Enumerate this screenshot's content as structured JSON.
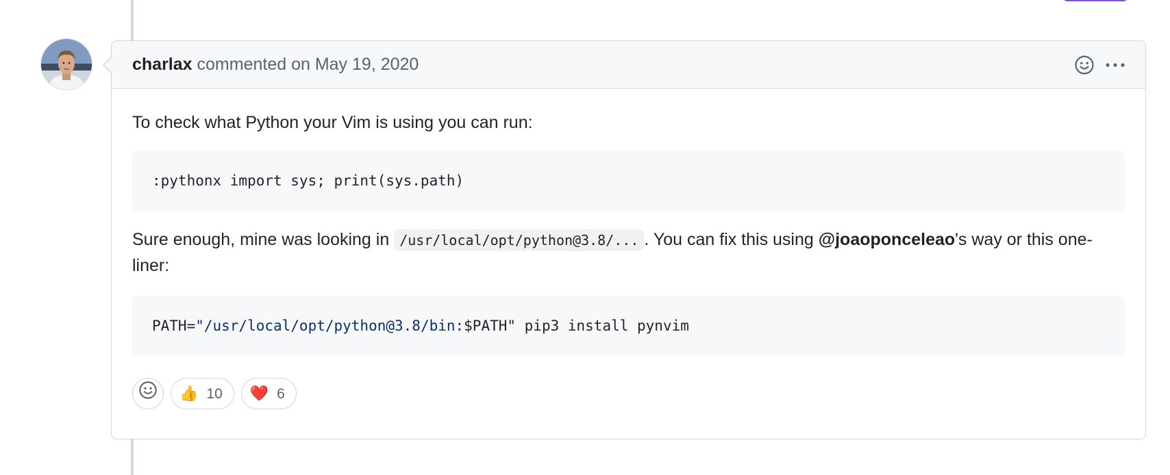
{
  "comment": {
    "author": "charlax",
    "action_text": " commented on May 19, 2020",
    "body": {
      "para1": "To check what Python your Vim is using you can run:",
      "code1": ":pythonx import sys; print(sys.path)",
      "para2_before": "Sure enough, mine was looking in ",
      "para2_code": "/usr/local/opt/python@3.8/...",
      "para2_middle": ". You can fix this using ",
      "para2_mention": "@joaoponceleao",
      "para2_after": "'s way or this one-liner:",
      "code2_prefix": "PATH=",
      "code2_string": "\"/usr/local/opt/python@3.8/bin:",
      "code2_var": "$PATH\"",
      "code2_rest": " pip3 install pynvim"
    },
    "reactions": [
      {
        "emoji": "👍",
        "emoji_name": "thumbs-up",
        "count": "10"
      },
      {
        "emoji": "❤️",
        "emoji_name": "heart",
        "count": "6"
      }
    ]
  },
  "icons": {
    "add_reaction": "smiley-icon",
    "more": "kebab-horizontal-icon"
  }
}
